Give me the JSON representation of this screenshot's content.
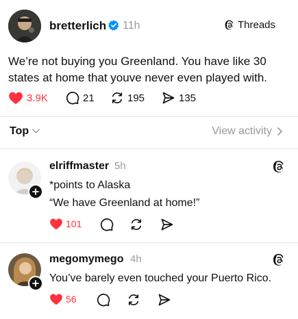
{
  "post": {
    "username": "bretterlich",
    "time": "11h",
    "brand": "Threads",
    "text_line1": "We’re not buying you Greenland. You have like 30",
    "text_line2": "states at home that youve never even played with.",
    "likes": "3.9K",
    "replies": "21",
    "reposts": "195",
    "shares": "135"
  },
  "sort": {
    "label": "Top",
    "view_activity": "View activity"
  },
  "replies": [
    {
      "username": "elriffmaster",
      "time": "5h",
      "line1": "*points to Alaska",
      "line2": "“We have Greenland at home!”",
      "likes": "101"
    },
    {
      "username": "megomymego",
      "time": "4h",
      "line1": "You’ve barely even touched your Puerto Rico.",
      "likes": "56"
    }
  ],
  "colors": {
    "like": "#ff3040",
    "verified": "#0095f6",
    "muted": "#9a9a9a",
    "divider": "#e6e6e6"
  }
}
